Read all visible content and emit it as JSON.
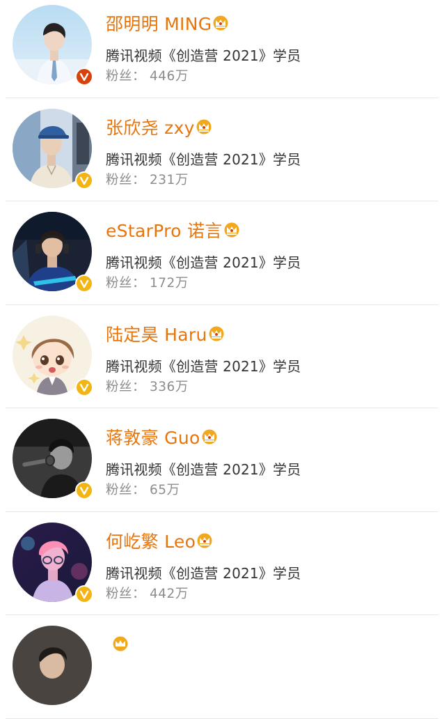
{
  "colors": {
    "name": "#e8750b",
    "verified_red": "#d8410c",
    "verified_gold": "#f2b514",
    "crown": "#f1a81d"
  },
  "fans_label": "粉丝：",
  "users": [
    {
      "name": "邵明明 MING",
      "description": "腾讯视频《创造营 2021》学员",
      "fans_count": "446万",
      "verified_badge": "red-v-icon",
      "avatar": "photo-avatar-sky"
    },
    {
      "name": "张欣尧 zxy",
      "description": "腾讯视频《创造营 2021》学员",
      "fans_count": "231万",
      "verified_badge": "gold-v-icon",
      "avatar": "photo-avatar-cap"
    },
    {
      "name": "eStarPro 诺言",
      "description": "腾讯视频《创造营 2021》学员",
      "fans_count": "172万",
      "verified_badge": "gold-v-icon",
      "avatar": "photo-avatar-gaming"
    },
    {
      "name": "陆定昊 Haru",
      "description": "腾讯视频《创造营 2021》学员",
      "fans_count": "336万",
      "verified_badge": "gold-v-icon",
      "avatar": "cartoon-avatar"
    },
    {
      "name": "蒋敦豪 Guo",
      "description": "腾讯视频《创造营 2021》学员",
      "fans_count": "65万",
      "verified_badge": "gold-v-icon",
      "avatar": "photo-avatar-microphone"
    },
    {
      "name": "何屹繁 Leo",
      "description": "腾讯视频《创造营 2021》学员",
      "fans_count": "442万",
      "verified_badge": "gold-v-icon",
      "avatar": "photo-avatar-neon"
    }
  ]
}
